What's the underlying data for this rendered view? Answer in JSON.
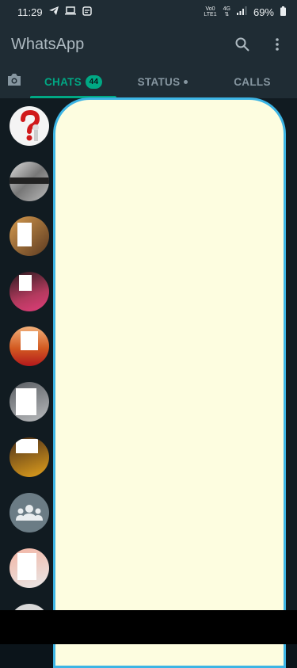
{
  "status_bar": {
    "time": "11:29",
    "network_top": "Vo0",
    "network_bottom": "LTE1",
    "signal_label": "4G",
    "battery": "69%"
  },
  "app": {
    "title": "WhatsApp",
    "icons": {
      "search": "search-icon",
      "menu": "more-vert-icon"
    }
  },
  "tabs": [
    {
      "label": "CHATS",
      "badge": "44",
      "active": true
    },
    {
      "label": "STATUS",
      "has_dot": true
    },
    {
      "label": "CALLS"
    }
  ],
  "chat_avatars": [
    "question-mark-avatar",
    "engineering-avatar",
    "photo-avatar",
    "photo-avatar",
    "photo-avatar",
    "photo-avatar",
    "photo-avatar",
    "group-avatar",
    "photo-avatar",
    "photo-avatar"
  ],
  "colors": {
    "accent": "#00a884",
    "header": "#1f2c34",
    "overlay_fill": "#fdfde0",
    "overlay_border": "#3cb4e4"
  }
}
